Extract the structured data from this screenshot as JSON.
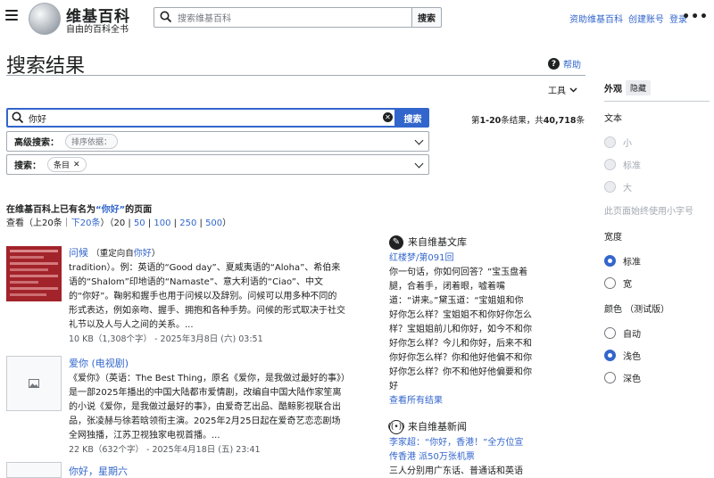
{
  "header": {
    "site_title": "维基百科",
    "tagline": "自由的百科全书",
    "search_placeholder": "搜索维基百科",
    "search_button": "搜索",
    "links": [
      "资助维基百科",
      "创建账号",
      "登录"
    ]
  },
  "page": {
    "title": "搜索结果",
    "help": "帮助",
    "tools": "工具"
  },
  "search": {
    "query": "你好",
    "button": "搜索",
    "results_prefix": "第",
    "results_range": "1-20",
    "results_mid": "条结果，共",
    "results_total": "40,718",
    "results_suffix": "条",
    "advanced_label": "高级搜索：",
    "advanced_chip": "排序依据：",
    "scope_label": "搜索：",
    "scope_chip": "条目"
  },
  "exists": {
    "heading_prefix": "在维基百科上已有名为",
    "heading_term": "“你好”",
    "heading_suffix": "的页面",
    "pager_text": "查看（上20条｜",
    "pager_next": "下20条",
    "pager_mid": "）（",
    "sizes": [
      "20",
      "50",
      "100",
      "250",
      "500"
    ],
    "pager_end": "）"
  },
  "results": [
    {
      "title": "问候",
      "redirect": "（重定向自",
      "redirect_link": "你好",
      "redirect_end": "）",
      "snippet": "tradition）。例：英语的“Good day”、夏威夷语的“Aloha”、希伯来语的“Shalom”印地语的“Namaste”、意大利语的“Ciao”、中文的“你好”。鞠躬和握手也用于问候以及辞别。问候可以用多种不同的形式表达，例如亲吻、握手、拥抱和各种手势。问候的形式取决于社交礼节以及人与人之间的关系。...",
      "meta": "10 KB（1,308个字） - 2025年3月8日 (六) 03:51"
    },
    {
      "title": "爱你 (电视剧)",
      "snippet": "《爱你》（英语：The Best Thing，原名《爱你，是我做过最好的事》）是一部2025年播出的中国大陆都市爱情剧，改编自中国大陆作家笙离的小说《爱你，是我做过最好的事》，由爱奇艺出品、酷鲸影视联合出品，张凌赫与徐若晗领衔主演。2025年2月25日起在爱奇艺恋恋剧场全网独播，江苏卫视独家电视首播。...",
      "meta": "22 KB（632个字） - 2025年4月18日 (五) 23:41"
    },
    {
      "title": "你好，星期六"
    }
  ],
  "sister": [
    {
      "project": "来自维基文库",
      "link": "红楼梦/第091回",
      "text": "你一句话，你如何回答？”宝玉盘着腿，合着手，闭着眼，嘘着嘴道：“讲来。”黛玉道：“宝姐姐和你好你怎么样？宝姐姐不和你好你怎么样？宝姐姐前儿和你好，如今不和你好你怎么样？今儿和你好，后来不和你好你怎么样？你和他好他偏不和你好你怎么样？你不和他好他偏要和你好",
      "more": "查看所有结果"
    },
    {
      "project": "来自维基新闻",
      "link": "李家超：“你好，香港！”全方位宣传香港 派50万张机票",
      "text": "三人分别用广东话、普通话和英语"
    }
  ],
  "appearance": {
    "title": "外观",
    "hide": "隐藏",
    "text_label": "文本",
    "text_options": [
      "小",
      "标准",
      "大"
    ],
    "text_note": "此页面始终使用小字号",
    "width_label": "宽度",
    "width_options": [
      "标准",
      "宽"
    ],
    "color_label": "颜色 （测试版）",
    "color_options": [
      "自动",
      "浅色",
      "深色"
    ]
  },
  "colors": {
    "accent": "#3366cc",
    "border": "#a2a9b1",
    "thumb_red": "#a3232a"
  }
}
